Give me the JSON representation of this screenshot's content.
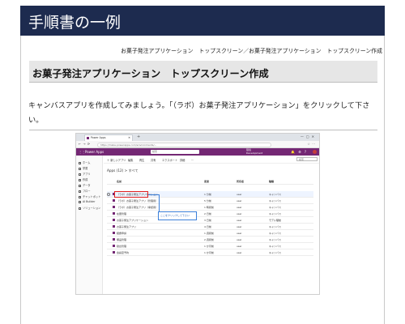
{
  "header": {
    "title": "手順書の一例"
  },
  "breadcrumb": "お菓子発注アプリケーション　トップスクリーン／お菓子発注アプリケーション　トップスクリーン作成",
  "section": {
    "heading": "お菓子発注アプリケーション　トップスクリーン作成"
  },
  "instruction": "キャンバスアプリを作成してみましょう。「（ラボ）お菓子発注アプリケーション」をクリックして下さい。",
  "screenshot": {
    "tab_label": "Power Apps",
    "url": "https://make.powerapps.com/environments/...",
    "app_name": "Power Apps",
    "search_placeholder": "検索",
    "environment": "環境\nDevelopment",
    "left_nav": [
      "ホーム",
      "学習",
      "アプリ",
      "作成",
      "データ",
      "フロー",
      "チャットボット",
      "AI Builder",
      "ソリューション"
    ],
    "commands": [
      "＋ 新しいアプリ",
      "編集",
      "再生",
      "共有",
      "エクスポート",
      "詳細",
      "…"
    ],
    "command_search": "検索",
    "crumb": "Apps (12) > すべて",
    "columns": [
      "名前",
      "変更",
      "所有者",
      "種類"
    ],
    "rows": [
      {
        "name": "（ラボ）お菓子発注アプリケーション",
        "modified": "1 分前",
        "owner": "user",
        "type": "キャンバス"
      },
      {
        "name": "（ラボ）お菓子発注アプリ（管理用）",
        "modified": "5 分前",
        "owner": "user",
        "type": "キャンバス"
      },
      {
        "name": "（ラボ）お菓子発注アプリ（承認用）",
        "modified": "1 時間前",
        "owner": "user",
        "type": "キャンバス"
      },
      {
        "name": "在庫管理",
        "modified": "2 日前",
        "owner": "user",
        "type": "キャンバス"
      },
      {
        "name": "お菓子発注アプリケーション",
        "modified": "3 日前",
        "owner": "user",
        "type": "モデル駆動"
      },
      {
        "name": "お菓子発注アプリ",
        "modified": "4 日前",
        "owner": "user",
        "type": "キャンバス"
      },
      {
        "name": "経費申請",
        "modified": "1 週間前",
        "owner": "user",
        "type": "キャンバス"
      },
      {
        "name": "備品管理",
        "modified": "2 週間前",
        "owner": "user",
        "type": "キャンバス"
      },
      {
        "name": "勤怠管理",
        "modified": "1 か月前",
        "owner": "user",
        "type": "キャンバス"
      },
      {
        "name": "会議室予約",
        "modified": "1 か月前",
        "owner": "user",
        "type": "キャンバス"
      }
    ],
    "callout": "ここをクリックして下さい"
  },
  "colors": {
    "header_bg": "#1d2b4f",
    "powerapps_purple": "#742774",
    "highlight": "#e02020",
    "callout": "#3b7fd9"
  }
}
